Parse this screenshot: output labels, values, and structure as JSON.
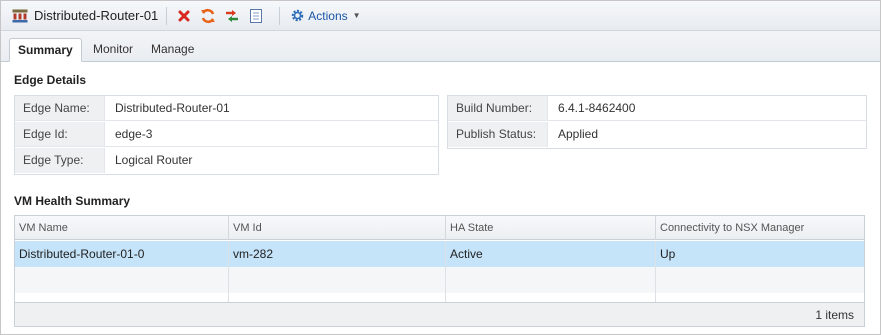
{
  "toolbar": {
    "title": "Distributed-Router-01",
    "edge_icon": "edge-router-icon",
    "buttons": [
      {
        "name": "delete-button",
        "icon": "red-x-icon",
        "color": "#d9281d"
      },
      {
        "name": "refresh-button",
        "icon": "refresh-icon",
        "color": "#e8631a"
      },
      {
        "name": "move-button",
        "icon": "transfer-arrows-icon",
        "color": "#d93a1d"
      },
      {
        "name": "notes-button",
        "icon": "notepad-icon",
        "color": "#5a79a8"
      }
    ],
    "actions_label": "Actions",
    "actions_icon": "gear-icon"
  },
  "tabs": [
    {
      "label": "Summary",
      "active": true
    },
    {
      "label": "Monitor",
      "active": false
    },
    {
      "label": "Manage",
      "active": false
    }
  ],
  "edge_details": {
    "section_label": "Edge Details",
    "left": [
      {
        "label": "Edge Name:",
        "value": "Distributed-Router-01"
      },
      {
        "label": "Edge Id:",
        "value": "edge-3"
      },
      {
        "label": "Edge Type:",
        "value": "Logical Router"
      }
    ],
    "right": [
      {
        "label": "Build Number:",
        "value": "6.4.1-8462400"
      },
      {
        "label": "Publish Status:",
        "value": "Applied"
      }
    ]
  },
  "vm_health": {
    "section_label": "VM Health Summary",
    "columns": [
      "VM Name",
      "VM Id",
      "HA State",
      "Connectivity to NSX Manager"
    ],
    "rows": [
      [
        "Distributed-Router-01-0",
        "vm-282",
        "Active",
        "Up"
      ]
    ],
    "footer_count": "1 items"
  },
  "colors": {
    "selection": "#c5e3f9",
    "link": "#1a55a5"
  }
}
